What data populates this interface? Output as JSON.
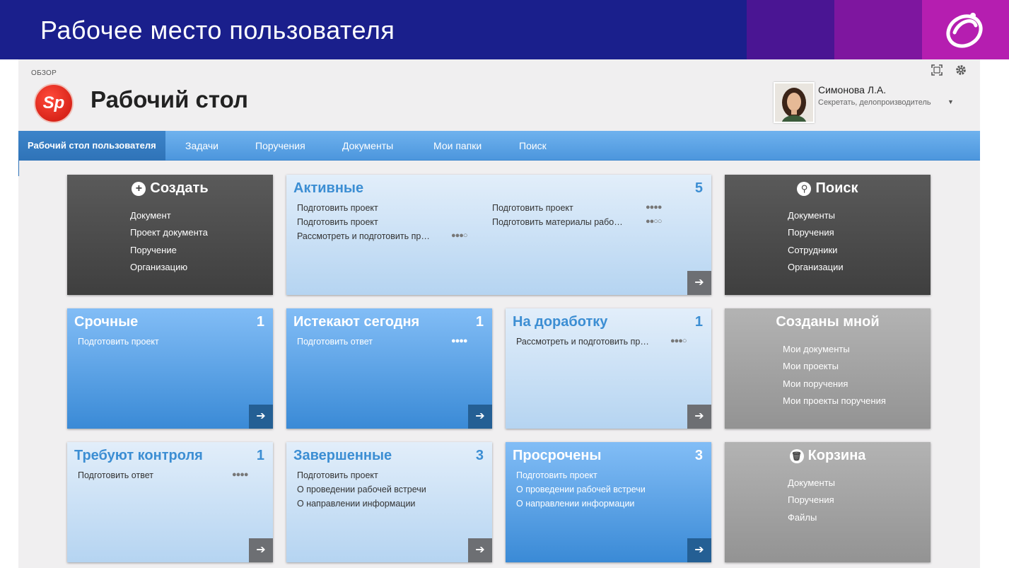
{
  "slide": {
    "title": "Рабочее место пользователя"
  },
  "app": {
    "breadcrumb": "ОБЗОР",
    "logo_text": "Sp",
    "page_title": "Рабочий стол",
    "user": {
      "name": "Симонова Л.А.",
      "role": "Секретать, делопроизводитель"
    }
  },
  "nav": {
    "items": [
      {
        "label": "Рабочий стол пользователя"
      },
      {
        "label": "Задачи"
      },
      {
        "label": "Поручения"
      },
      {
        "label": "Документы"
      },
      {
        "label": "Мои папки"
      },
      {
        "label": "Поиск"
      }
    ]
  },
  "tiles": {
    "create": {
      "title": "Создать",
      "items": [
        "Документ",
        "Проект документа",
        "Поручение",
        "Организацию"
      ]
    },
    "active": {
      "title": "Активные",
      "count": "5",
      "items": [
        {
          "label": "Подготовить проект"
        },
        {
          "label": "Подготовить проект",
          "dots": "●●●●"
        },
        {
          "label": "Подготовить проект"
        },
        {
          "label": "Подготовить материалы рабо…",
          "dots": "●●○○"
        },
        {
          "label": "Рассмотреть и подготовить пр…",
          "dots": "●●●○"
        }
      ]
    },
    "search": {
      "title": "Поиск",
      "items": [
        "Документы",
        "Поручения",
        "Сотрудники",
        "Организации"
      ]
    },
    "urgent": {
      "title": "Срочные",
      "count": "1",
      "items": [
        {
          "label": "Подготовить проект"
        }
      ]
    },
    "expiring": {
      "title": "Истекают сегодня",
      "count": "1",
      "items": [
        {
          "label": "Подготовить ответ",
          "dots": "●●●●"
        }
      ]
    },
    "rework": {
      "title": "На доработку",
      "count": "1",
      "items": [
        {
          "label": "Рассмотреть и подготовить пр…",
          "dots": "●●●○"
        }
      ]
    },
    "mine": {
      "title": "Созданы мной",
      "items": [
        "Мои документы",
        "Мои проекты",
        "Мои поручения",
        "Мои проекты поручения"
      ]
    },
    "control": {
      "title": "Требуют контроля",
      "count": "1",
      "items": [
        {
          "label": "Подготовить ответ",
          "dots": "●●●●"
        }
      ]
    },
    "done": {
      "title": "Завершенные",
      "count": "3",
      "items": [
        {
          "label": "Подготовить проект"
        },
        {
          "label": "О проведении рабочей встречи"
        },
        {
          "label": "О направлении информации"
        }
      ]
    },
    "overdue": {
      "title": "Просрочены",
      "count": "3",
      "items": [
        {
          "label": "Подготовить проект"
        },
        {
          "label": "О проведении рабочей встречи"
        },
        {
          "label": "О направлении информации"
        }
      ]
    },
    "trash": {
      "title": "Корзина",
      "items": [
        "Документы",
        "Поручения",
        "Файлы"
      ]
    }
  },
  "icons": {
    "arrow": "arrow-right-icon",
    "fullscreen": "fullscreen-icon",
    "settings": "gear-icon"
  }
}
